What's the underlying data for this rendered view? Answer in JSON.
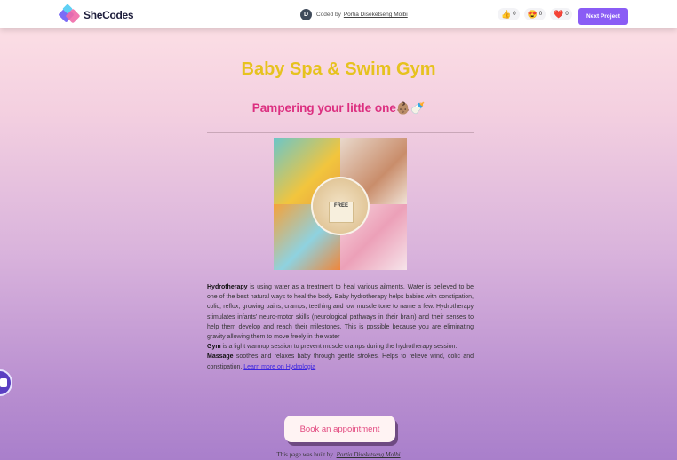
{
  "header": {
    "brand": "SheCodes",
    "avatar_letter": "D",
    "coded_by_label": "Coded by",
    "author": "Portia Diseketseng Molbi",
    "reactions": [
      {
        "icon": "thumbs-up-icon",
        "glyph": "👍",
        "count": "0"
      },
      {
        "icon": "heart-eyes-icon",
        "glyph": "😍",
        "count": "0"
      },
      {
        "icon": "heart-icon",
        "glyph": "❤️",
        "count": "0"
      }
    ],
    "next_button": "Next Project"
  },
  "main": {
    "title": "Baby Spa & Swim Gym",
    "subtitle": "Pampering your little one",
    "subtitle_emojis": "👶🏽🍼",
    "photo_badge": "FREE",
    "paragraphs": {
      "hydro_term": "Hydrotherapy",
      "hydro_text": " is using water as a treatment to heal various ailments. Water is believed to be one of the best natural ways to heal the body. Baby hydrotherapy helps babies with constipation, colic, reflux, growing pains, cramps, teething and low muscle tone to name a few. Hydrotherapy stimulates infants' neuro-motor skills (neurological pathways in their brain) and their senses to help them develop and reach their milestones. This is possible because you are eliminating gravity allowing them to move freely in the water",
      "gym_term": "Gym",
      "gym_text": " is a light warmup session to prevent muscle cramps during the hydrotherapy session.",
      "massage_term": "Massage",
      "massage_text": " soothes and relaxes baby through gentle strokes. Helps to relieve wind, colic and constipation. ",
      "link_text": "Learn more on Hydrologia"
    },
    "book_button": "Book an appointment",
    "footer_text": "This page was built by",
    "footer_author": "Portia Diseketseng Molbi"
  }
}
